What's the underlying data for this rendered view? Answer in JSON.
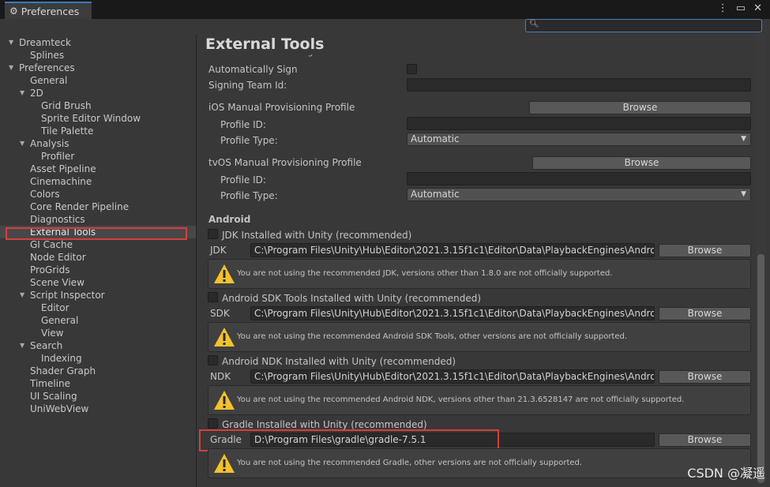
{
  "window": {
    "tab_title": "Preferences",
    "controls": [
      "⋮",
      "▭",
      "✕"
    ]
  },
  "sidebar": {
    "items": [
      {
        "label": "Dreamteck",
        "level": 0,
        "arrow": "▼"
      },
      {
        "label": "Splines",
        "level": 1
      },
      {
        "label": "Preferences",
        "level": 0,
        "arrow": "▼"
      },
      {
        "label": "General",
        "level": 1
      },
      {
        "label": "2D",
        "level": 1,
        "arrow": "▼"
      },
      {
        "label": "Grid Brush",
        "level": 2
      },
      {
        "label": "Sprite Editor Window",
        "level": 2
      },
      {
        "label": "Tile Palette",
        "level": 2
      },
      {
        "label": "Analysis",
        "level": 1,
        "arrow": "▼"
      },
      {
        "label": "Profiler",
        "level": 2
      },
      {
        "label": "Asset Pipeline",
        "level": 1
      },
      {
        "label": "Cinemachine",
        "level": 1
      },
      {
        "label": "Colors",
        "level": 1
      },
      {
        "label": "Core Render Pipeline",
        "level": 1
      },
      {
        "label": "Diagnostics",
        "level": 1
      },
      {
        "label": "External Tools",
        "level": 1,
        "selected": true
      },
      {
        "label": "GI Cache",
        "level": 1
      },
      {
        "label": "Node Editor",
        "level": 1
      },
      {
        "label": "ProGrids",
        "level": 1
      },
      {
        "label": "Scene View",
        "level": 1
      },
      {
        "label": "Script Inspector",
        "level": 1,
        "arrow": "▼"
      },
      {
        "label": "Editor",
        "level": 2
      },
      {
        "label": "General",
        "level": 2
      },
      {
        "label": "View",
        "level": 2
      },
      {
        "label": "Search",
        "level": 1,
        "arrow": "▼"
      },
      {
        "label": "Indexing",
        "level": 2
      },
      {
        "label": "Shader Graph",
        "level": 1
      },
      {
        "label": "Timeline",
        "level": 1
      },
      {
        "label": "UI Scaling",
        "level": 1
      },
      {
        "label": "UniWebView",
        "level": 1
      }
    ]
  },
  "main": {
    "title": "External Tools",
    "cut_heading": "Xcode Default Settings",
    "auto_sign_label": "Automatically Sign",
    "signing_team_label": "Signing Team Id:",
    "ios": {
      "section_label": "iOS Manual Provisioning Profile",
      "browse": "Browse",
      "profile_id_label": "Profile ID:",
      "profile_type_label": "Profile Type:",
      "profile_type_value": "Automatic"
    },
    "tvos": {
      "section_label": "tvOS Manual Provisioning Profile",
      "browse": "Browse",
      "profile_id_label": "Profile ID:",
      "profile_type_label": "Profile Type:",
      "profile_type_value": "Automatic"
    },
    "android": {
      "heading": "Android",
      "jdk": {
        "checkbox_label": "JDK Installed with Unity (recommended)",
        "label": "JDK",
        "path": "C:\\Program Files\\Unity\\Hub\\Editor\\2021.3.15f1c1\\Editor\\Data\\PlaybackEngines\\AndroidPlayer\\OpenJDK",
        "browse": "Browse",
        "warning": "You are not using the recommended JDK, versions other than 1.8.0 are not officially supported."
      },
      "sdk": {
        "checkbox_label": "Android SDK Tools Installed with Unity (recommended)",
        "label": "SDK",
        "path": "C:\\Program Files\\Unity\\Hub\\Editor\\2021.3.15f1c1\\Editor\\Data\\PlaybackEngines\\AndroidPlayer\\SDK",
        "browse": "Browse",
        "warning": "You are not using the recommended Android SDK Tools, other versions are not officially supported."
      },
      "ndk": {
        "checkbox_label": "Android NDK Installed with Unity (recommended)",
        "label": "NDK",
        "path": "C:\\Program Files\\Unity\\Hub\\Editor\\2021.3.15f1c1\\Editor\\Data\\PlaybackEngines\\AndroidPlayer\\NDK",
        "browse": "Browse",
        "warning": "You are not using the recommended Android NDK, versions other than 21.3.6528147 are not officially supported."
      },
      "gradle": {
        "checkbox_label": "Gradle Installed with Unity (recommended)",
        "label": "Gradle",
        "path": "D:\\Program Files\\gradle\\gradle-7.5.1",
        "browse": "Browse",
        "warning": "You are not using the recommended Gradle, other versions are not officially supported."
      }
    }
  },
  "watermark": "CSDN @凝遥",
  "colors": {
    "background": "#383838",
    "field": "#2a2a2a",
    "highlight": "#d23f3f",
    "accent": "#3a79bb",
    "warning": "#f2c12e"
  }
}
